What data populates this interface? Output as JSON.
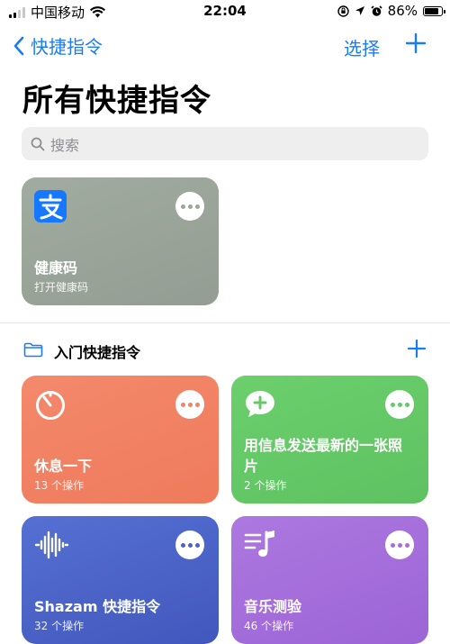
{
  "status": {
    "carrier": "中国移动",
    "time": "22:04",
    "battery": "86%",
    "battery_level": 0.86
  },
  "nav": {
    "back_label": "快捷指令",
    "select_label": "选择"
  },
  "page": {
    "title": "所有快捷指令"
  },
  "search": {
    "placeholder": "搜索"
  },
  "featured": {
    "title": "健康码",
    "subtitle": "打开健康码",
    "icon": "alipay-icon",
    "color": "#9aa59a"
  },
  "section": {
    "title": "入门快捷指令"
  },
  "cards": [
    {
      "title": "休息一下",
      "subtitle": "13 个操作",
      "icon": "timer-icon",
      "color": "#f28264"
    },
    {
      "title": "用信息发送最新的一张照片",
      "subtitle": "2 个操作",
      "icon": "message-plus-icon",
      "color": "#66c968"
    },
    {
      "title": "Shazam 快捷指令",
      "subtitle": "32 个操作",
      "icon": "waveform-icon",
      "color": "#4a62c8"
    },
    {
      "title": "音乐测验",
      "subtitle": "46 个操作",
      "icon": "music-note-icon",
      "color": "#a56edb"
    }
  ],
  "colors": {
    "accent": "#1a7cf5"
  }
}
